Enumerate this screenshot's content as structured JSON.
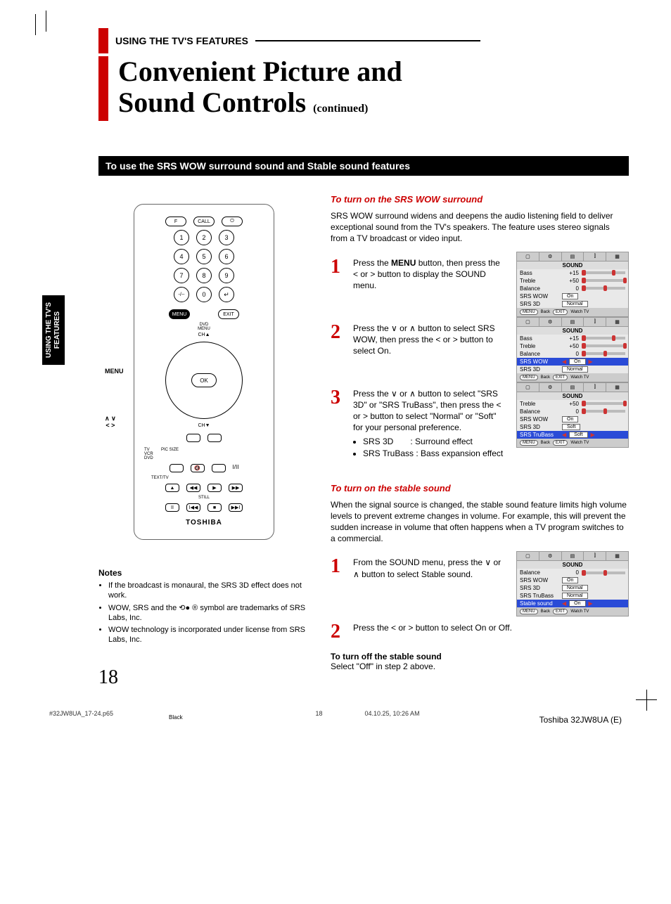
{
  "kicker": "USING THE TV'S FEATURES",
  "title_line1": "Convenient Picture and",
  "title_line2": "Sound Controls",
  "title_cont": "(continued)",
  "section_bar": "To use the SRS WOW surround sound and Stable sound features",
  "side_tab": "USING THE TV'S\nFEATURES",
  "remote": {
    "labels": {
      "menu": "MENU",
      "arrows": "∧ ∨\n< >"
    },
    "row1": [
      "F",
      "CALL",
      "⏻"
    ],
    "nums1": [
      "1",
      "2",
      "3"
    ],
    "nums2": [
      "4",
      "5",
      "6"
    ],
    "nums3": [
      "7",
      "8",
      "9"
    ],
    "nums4": [
      "-/--",
      "0",
      "↵"
    ],
    "menu_btn": "MENU",
    "exit_btn": "EXIT",
    "dvd_menu": "DVD\nMENU",
    "ch_up": "CH▲",
    "ch_dn": "CH▼",
    "ok": "OK",
    "tv": "TV",
    "vcr": "VCR",
    "dvd": "DVD",
    "picsize": "PIC SIZE",
    "mute": "🔇",
    "iII": "I/II",
    "texttv": "TEXT/TV",
    "still": "STILL",
    "brand": "TOSHIBA"
  },
  "srs": {
    "heading": "To turn on the SRS WOW surround",
    "intro": "SRS WOW surround widens and deepens the audio listening field to deliver exceptional sound from the TV's speakers. The feature uses stereo signals from a TV broadcast or video input.",
    "steps": [
      {
        "n": "1",
        "text_pre": "Press the ",
        "b1": "MENU",
        "text_mid": " button, then press the ",
        "sym1": "<",
        "or": " or ",
        "sym2": ">",
        "text_post": " button to display the SOUND menu."
      },
      {
        "n": "2",
        "text": "Press the ∨ or ∧ button to select SRS WOW, then press the < or > button to select On."
      },
      {
        "n": "3",
        "text": "Press the ∨ or ∧ button to select \"SRS 3D\" or \"SRS TruBass\", then press the < or > button to select \"Normal\" or \"Soft\" for your personal preference.",
        "bullets": [
          "SRS 3D  : Surround effect",
          "SRS TruBass : Bass expansion effect"
        ]
      }
    ]
  },
  "stable": {
    "heading": "To turn on the stable sound",
    "intro": "When the signal source is changed, the stable sound feature limits high volume levels to prevent extreme changes in volume. For example, this will prevent the sudden increase in volume that often happens when a TV program switches to a commercial.",
    "steps": [
      {
        "n": "1",
        "text": "From the SOUND menu, press the ∨ or ∧ button to select Stable sound."
      },
      {
        "n": "2",
        "text": "Press the < or > button to select On or Off."
      }
    ],
    "turnoff_h": "To turn off the stable sound",
    "turnoff_t": "Select \"Off\" in step 2 above."
  },
  "osd_common": {
    "tabs": [
      "▢",
      "⚙",
      "▤",
      "⫿",
      "▦"
    ],
    "title": "SOUND",
    "foot_menu": "MENU",
    "foot_back": "Back",
    "foot_exit": "EXIT",
    "foot_watch": "Watch TV"
  },
  "osd1": {
    "rows": [
      {
        "k": "Bass",
        "v": "+15",
        "slider": 70
      },
      {
        "k": "Treble",
        "v": "+50",
        "slider": 95
      },
      {
        "k": "Balance",
        "v": "0",
        "slider": 50
      },
      {
        "k": "SRS WOW",
        "box": "On"
      },
      {
        "k": "SRS 3D",
        "box": "Normal"
      }
    ],
    "hl": null
  },
  "osd2": {
    "rows": [
      {
        "k": "Bass",
        "v": "+15",
        "slider": 70
      },
      {
        "k": "Treble",
        "v": "+50",
        "slider": 95
      },
      {
        "k": "Balance",
        "v": "0",
        "slider": 50
      },
      {
        "k": "SRS WOW",
        "box": "On",
        "hl": true,
        "arrows": true
      },
      {
        "k": "SRS 3D",
        "box": "Normal"
      }
    ]
  },
  "osd3": {
    "rows": [
      {
        "k": "Treble",
        "v": "+50",
        "slider": 95
      },
      {
        "k": "Balance",
        "v": "0",
        "slider": 50
      },
      {
        "k": "SRS WOW",
        "box": "On"
      },
      {
        "k": "SRS 3D",
        "box": "Soft"
      },
      {
        "k": "SRS TruBass",
        "box": "Soft",
        "hl": true,
        "arrows": true
      }
    ]
  },
  "osd4": {
    "rows": [
      {
        "k": "Balance",
        "v": "0",
        "slider": 50
      },
      {
        "k": "SRS WOW",
        "box": "On"
      },
      {
        "k": "SRS 3D",
        "box": "Normal"
      },
      {
        "k": "SRS TruBass",
        "box": "Normal"
      },
      {
        "k": "Stable sound",
        "box": "On",
        "hl": true,
        "arrows": true
      }
    ]
  },
  "notes": {
    "heading": "Notes",
    "items": [
      "If the broadcast is monaural, the SRS 3D effect does not work.",
      "WOW, SRS and the ⟲● ® symbol are trademarks of SRS Labs, Inc.",
      "WOW technology is incorporated under license from SRS Labs, Inc."
    ]
  },
  "page_number": "18",
  "footer": {
    "file": "#32JW8UA_17-24.p65",
    "pg": "18",
    "ts": "04.10.25, 10:26 AM",
    "black": "Black"
  },
  "model": "Toshiba 32JW8UA (E)"
}
